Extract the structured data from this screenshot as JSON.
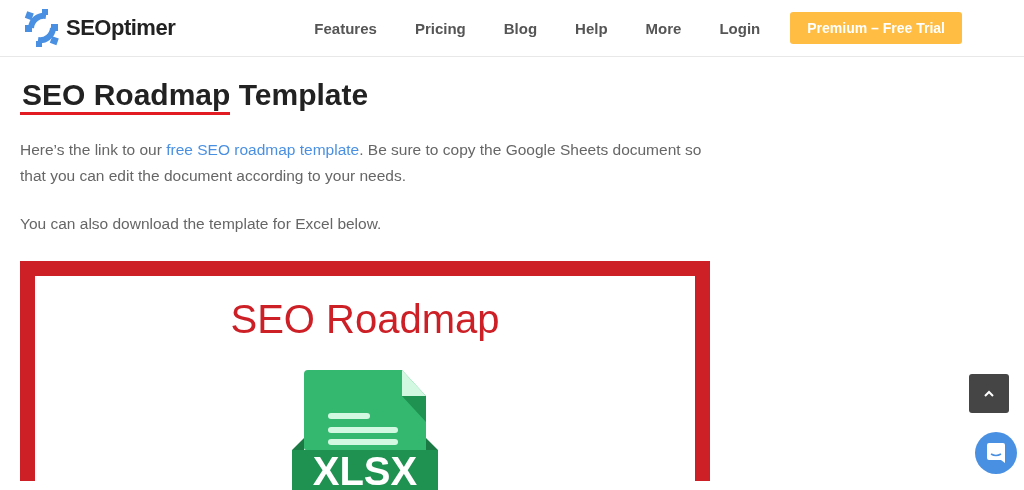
{
  "brand": "SEOptimer",
  "nav": [
    {
      "label": "Features"
    },
    {
      "label": "Pricing"
    },
    {
      "label": "Blog"
    },
    {
      "label": "Help"
    },
    {
      "label": "More"
    },
    {
      "label": "Login"
    }
  ],
  "cta": "Premium – Free Trial",
  "title": {
    "underlined": "SEO Roadmap",
    "rest": "Template"
  },
  "intro": {
    "before": "Here’s the link to our ",
    "link": "free SEO roadmap template",
    "after": ". Be sure to copy the Google Sheets document so that you can edit the document according to your needs."
  },
  "note": "You can also download the template for Excel below.",
  "figure": {
    "heading": "SEO Roadmap",
    "file_label": "XLSX"
  }
}
